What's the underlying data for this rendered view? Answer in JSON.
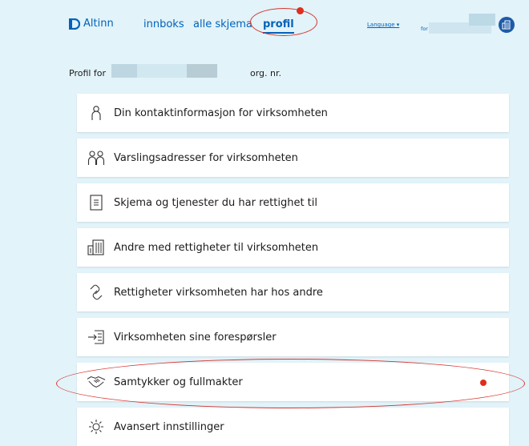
{
  "header": {
    "logo_text": "Altinn",
    "nav": {
      "innboks": "innboks",
      "alle_skjema": "alle skjema",
      "profil": "profil"
    },
    "language": "Language ▾",
    "for_label": "for"
  },
  "profile": {
    "prefix": "Profil for",
    "org_suffix": "org. nr."
  },
  "menu": {
    "items": [
      {
        "label": "Din kontaktinformasjon for virksomheten",
        "icon": "person-icon"
      },
      {
        "label": "Varslingsadresser for virksomheten",
        "icon": "people-icon"
      },
      {
        "label": "Skjema og tjenester du har rettighet til",
        "icon": "document-icon"
      },
      {
        "label": "Andre med rettigheter til virksomheten",
        "icon": "building-icon"
      },
      {
        "label": "Rettigheter virksomheten har hos andre",
        "icon": "link-icon"
      },
      {
        "label": "Virksomheten sine forespørsler",
        "icon": "request-icon"
      },
      {
        "label": "Samtykker og fullmakter",
        "icon": "handshake-icon"
      },
      {
        "label": "Avansert innstillinger",
        "icon": "gear-icon"
      }
    ]
  },
  "colors": {
    "background": "#e2f3f9",
    "link": "#0062ba",
    "badge": "#e02e1d",
    "annotation": "#d6342f"
  }
}
